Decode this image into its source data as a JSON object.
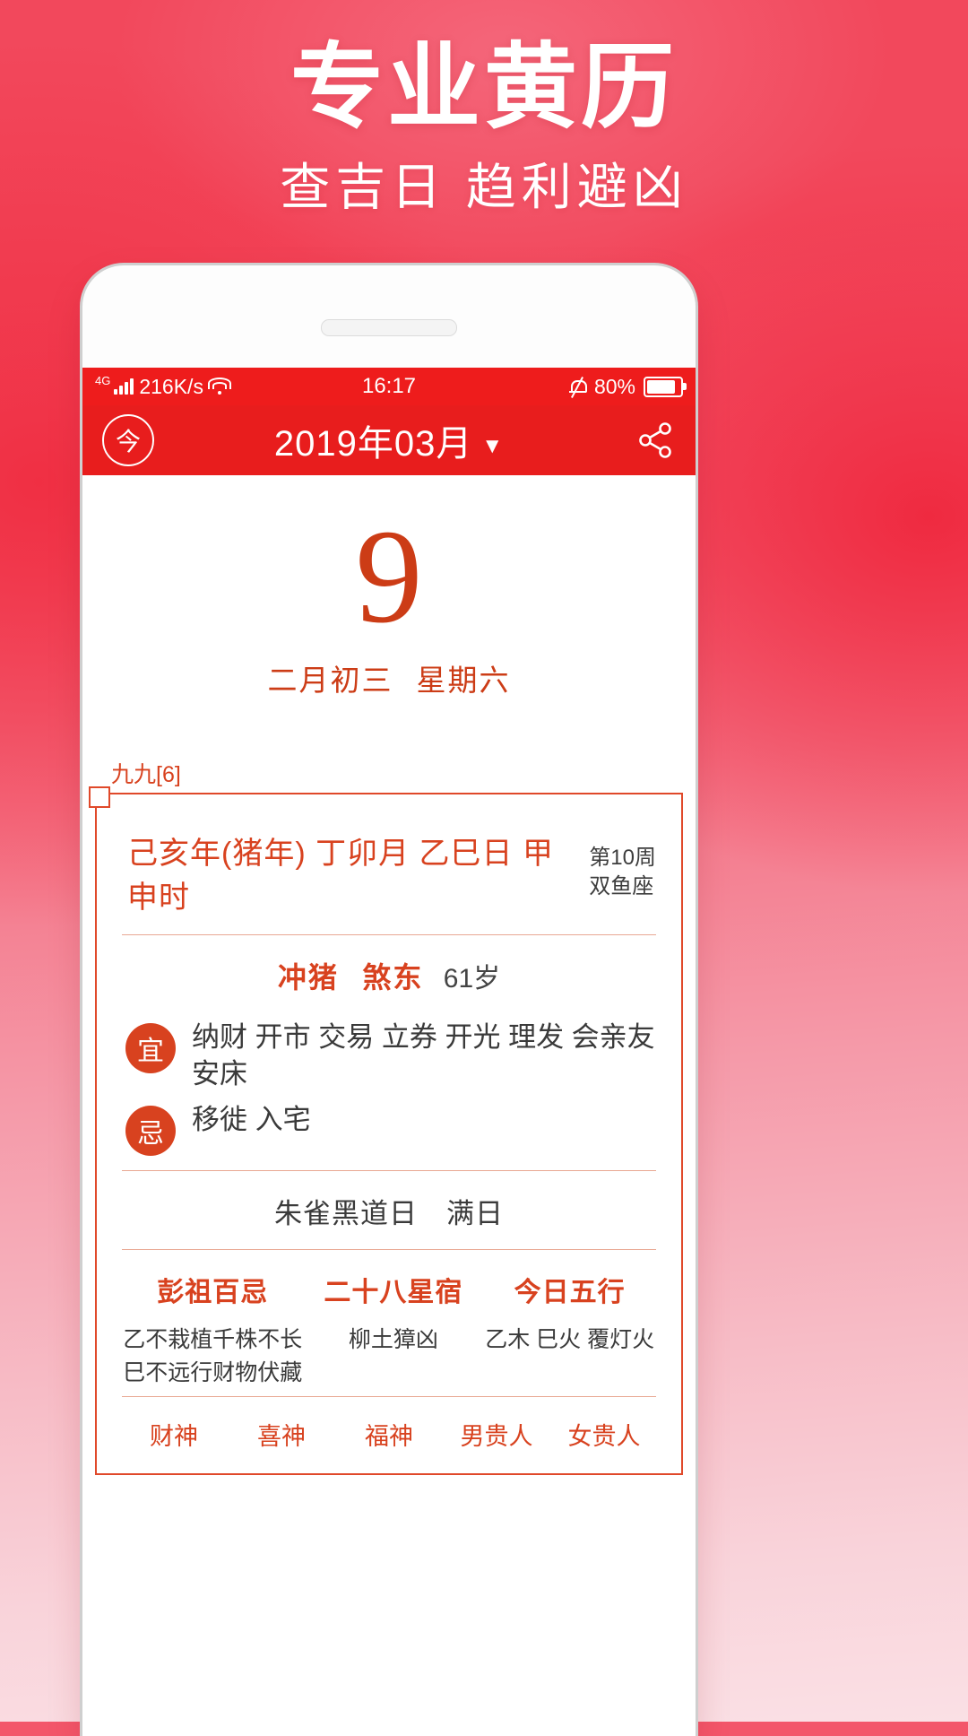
{
  "poster": {
    "title": "专业黄历",
    "subtitle": "查吉日 趋利避凶",
    "brand_red": "#ee1c1c",
    "accent_orange": "#d8421f"
  },
  "statusbar": {
    "network_type": "4G",
    "net_speed": "216K/s",
    "time": "16:17",
    "battery_percent": "80%",
    "signal_icon": "signal-bars-icon",
    "wifi_icon": "wifi-icon",
    "mute_icon": "bell-muted-icon",
    "battery_icon": "battery-icon"
  },
  "appbar": {
    "today_label": "今",
    "month_title": "2019年03月",
    "caret": "▼",
    "share_icon": "share-icon"
  },
  "hero": {
    "day": "9",
    "lunar_date": "二月初三",
    "weekday": "星期六"
  },
  "almanac": {
    "jiujiu": "九九[6]",
    "ganzhi": "己亥年(猪年)  丁卯月  乙巳日  甲申时",
    "week_of_year": "第10周",
    "zodiac_sign": "双鱼座",
    "chong": "冲猪",
    "sha": "煞东",
    "age": "61岁",
    "yi_badge": "宜",
    "yi_text": "纳财 开市 交易 立券 开光 理发 会亲友 安床",
    "ji_badge": "忌",
    "ji_text": "移徙 入宅",
    "shen_line": "朱雀黑道日　满日",
    "pengzu": {
      "title": "彭祖百忌",
      "lines": [
        "乙不栽植千株不长",
        "巳不远行财物伏藏"
      ]
    },
    "xingxiu": {
      "title": "二十八星宿",
      "lines": [
        "柳土獐凶"
      ]
    },
    "wuxing": {
      "title": "今日五行",
      "lines": [
        "乙木 巳火 覆灯火"
      ]
    },
    "gods": [
      "财神",
      "喜神",
      "福神",
      "男贵人",
      "女贵人"
    ]
  }
}
